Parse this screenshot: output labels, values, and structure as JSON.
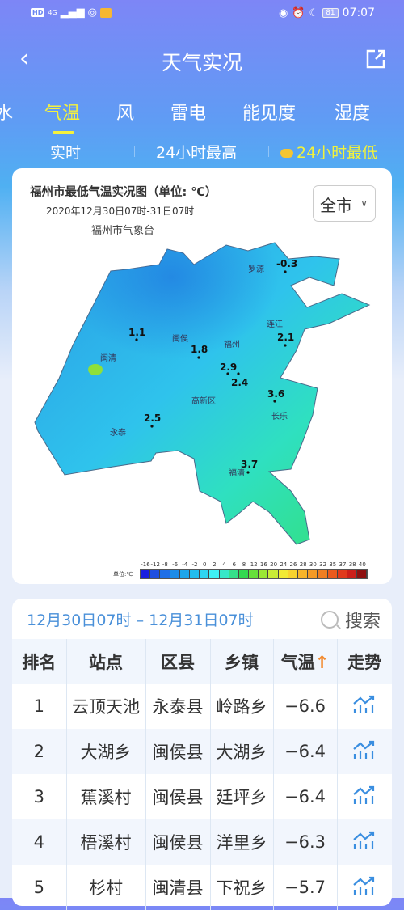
{
  "status_bar": {
    "time": "07:07",
    "battery": "81",
    "network": "4G"
  },
  "nav": {
    "title": "天气实况"
  },
  "tabs": [
    {
      "label": "水"
    },
    {
      "label": "气温",
      "active": true
    },
    {
      "label": "风"
    },
    {
      "label": "雷电"
    },
    {
      "label": "能见度"
    },
    {
      "label": "湿度"
    }
  ],
  "subtabs": [
    {
      "label": "实时"
    },
    {
      "label": "24小时最高"
    },
    {
      "label": "24小时最低",
      "active": true
    }
  ],
  "map": {
    "title": "福州市最低气温实况图（单位: ℃）",
    "subtitle": "2020年12月30日07时-31日07时",
    "org": "福州市气象台",
    "region_select": "全市",
    "places": [
      {
        "name": "罗源"
      },
      {
        "name": "连江"
      },
      {
        "name": "闽清"
      },
      {
        "name": "闽侯"
      },
      {
        "name": "福州"
      },
      {
        "name": "高新区"
      },
      {
        "name": "长乐"
      },
      {
        "name": "永泰"
      },
      {
        "name": "福清"
      }
    ],
    "values": [
      "-0.3",
      "2.1",
      "1.1",
      "1.8",
      "2.9",
      "2.4",
      "3.6",
      "2.5",
      "3.7"
    ],
    "legend": {
      "unit": "单位:℃",
      "ticks": [
        "-16",
        "-12",
        "-8",
        "-6",
        "-4",
        "-2",
        "0",
        "2",
        "4",
        "6",
        "8",
        "12",
        "16",
        "20",
        "24",
        "26",
        "28",
        "30",
        "32",
        "35",
        "37",
        "38",
        "40"
      ],
      "colors": [
        "#1a1ee0",
        "#1f4fe0",
        "#1f6fe8",
        "#1c8ce8",
        "#1ea6ec",
        "#22bdee",
        "#2fd5f0",
        "#3ff0f4",
        "#37e8c8",
        "#35e08a",
        "#33d850",
        "#66e03a",
        "#9be834",
        "#c9ec36",
        "#f1ea34",
        "#f8d22e",
        "#f8b42a",
        "#f59a26",
        "#f07e22",
        "#ea5a1e",
        "#e03a1c",
        "#cc1f1a",
        "#8e1010"
      ]
    }
  },
  "table": {
    "date_range": "12月30日07时 – 12月31日07时",
    "search_label": "搜索",
    "headers": [
      "排名",
      "站点",
      "区县",
      "乡镇",
      "气温",
      "走势"
    ],
    "sort_arrow": "↑",
    "rows": [
      {
        "rank": "1",
        "station": "云顶天池",
        "county": "永泰县",
        "town": "岭路乡",
        "temp": "−6.6"
      },
      {
        "rank": "2",
        "station": "大湖乡",
        "county": "闽侯县",
        "town": "大湖乡",
        "temp": "−6.4"
      },
      {
        "rank": "3",
        "station": "蕉溪村",
        "county": "闽侯县",
        "town": "廷坪乡",
        "temp": "−6.4"
      },
      {
        "rank": "4",
        "station": "梧溪村",
        "county": "闽侯县",
        "town": "洋里乡",
        "temp": "−6.3"
      },
      {
        "rank": "5",
        "station": "杉村",
        "county": "闽清县",
        "town": "下祝乡",
        "temp": "−5.7"
      }
    ]
  },
  "colors": {
    "accent": "#f4f13d",
    "date_blue": "#4a90d9",
    "sort_arrow": "#f28a2e"
  }
}
